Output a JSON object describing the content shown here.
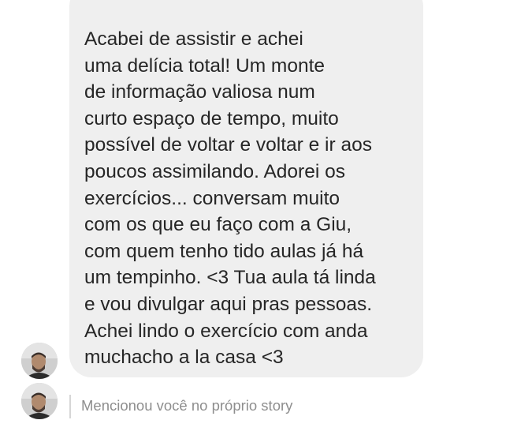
{
  "message": {
    "lines": [
      "Acabei de assistir e achei",
      "uma delícia total! Um monte",
      "de informação valiosa num",
      "curto espaço de tempo, muito",
      "possível de voltar e voltar e ir aos",
      "poucos assimilando. Adorei os",
      "exercícios... conversam muito",
      "com os que eu faço com a Giu,",
      "com quem tenho tido aulas já há",
      "um tempinho. <3 Tua aula tá linda",
      "e vou divulgar aqui pras pessoas.",
      "Achei lindo o exercício com anda",
      "muchacho a la casa <3"
    ]
  },
  "story_mention": {
    "text": "Mencionou você no próprio story"
  },
  "avatars": [
    {
      "icon": "user-avatar-icon"
    },
    {
      "icon": "user-avatar-icon"
    }
  ],
  "colors": {
    "bubble_background": "#efefef",
    "message_text": "#262626",
    "mention_text": "#8e8e8e",
    "mention_bar": "#d6d6d6"
  }
}
